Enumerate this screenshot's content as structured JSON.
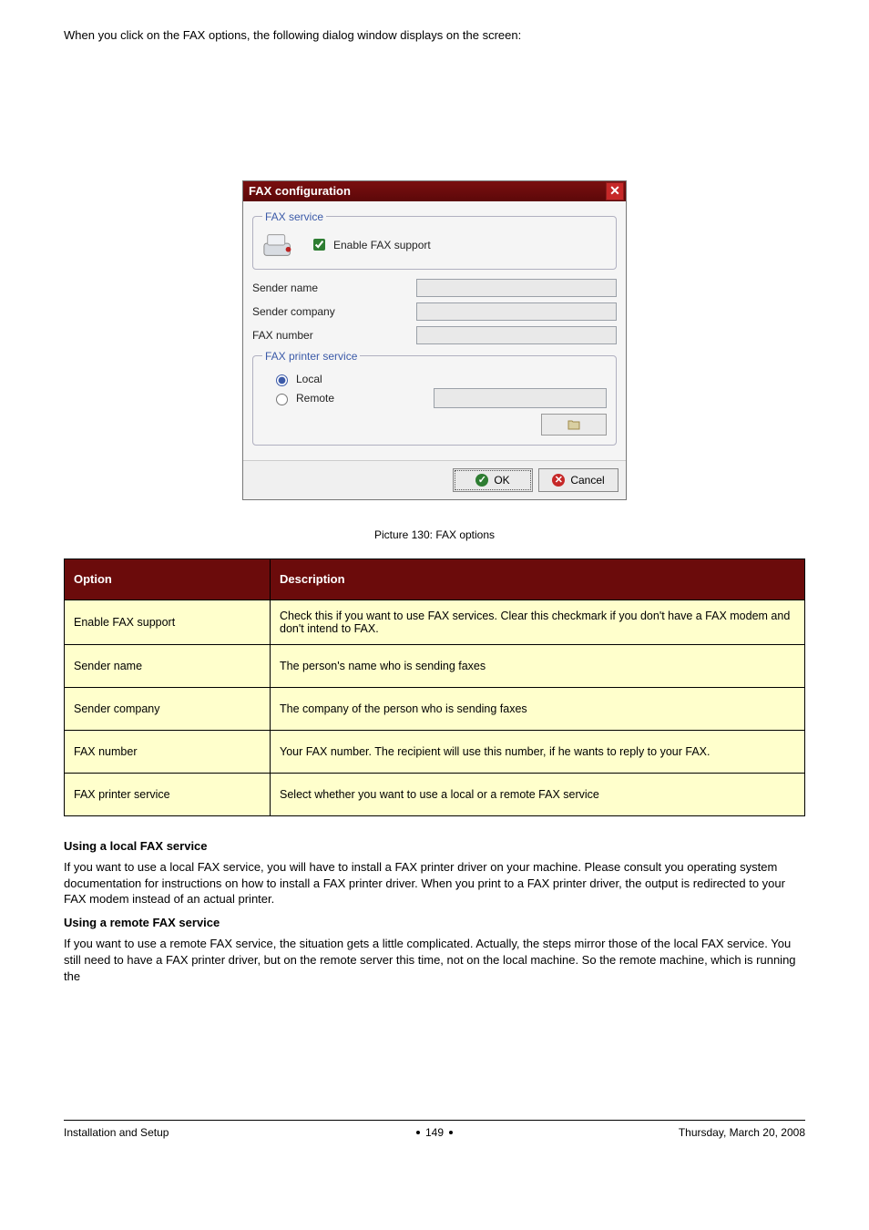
{
  "intro_paragraph": "When you click on the FAX options, the following dialog window displays on the screen:",
  "caption": "Picture 130: FAX options",
  "dialog": {
    "title": "FAX configuration",
    "group_fax_service_label": "FAX service",
    "enable_fax_label": "Enable FAX support",
    "enable_fax_checked": true,
    "fields": {
      "sender_name_label": "Sender name",
      "sender_name_value": "",
      "sender_company_label": "Sender company",
      "sender_company_value": "",
      "fax_number_label": "FAX number",
      "fax_number_value": ""
    },
    "group_printer_label": "FAX printer service",
    "radio_local_label": "Local",
    "radio_remote_label": "Remote",
    "radio_selected": "local",
    "remote_value": "",
    "ok_label": "OK",
    "cancel_label": "Cancel"
  },
  "table": {
    "headers": {
      "col1": "Option",
      "col2": "Description"
    },
    "rows": [
      {
        "opt": "Enable FAX support",
        "desc": "Check this if you want to use FAX services. Clear this checkmark if you don't have a FAX modem and don't intend to FAX."
      },
      {
        "opt": "Sender name",
        "desc": "The person's name who is sending faxes"
      },
      {
        "opt": "Sender company",
        "desc": "The company of the person who is sending faxes"
      },
      {
        "opt": "FAX number",
        "desc": "Your FAX number. The recipient will use this number, if he wants to reply to your FAX."
      },
      {
        "opt": "FAX printer service",
        "desc": "Select whether you want to use a local or a remote FAX service"
      }
    ]
  },
  "local_heading": "Using a local FAX service",
  "local_text": "If you want to use a local FAX service, you will have to install a FAX printer driver on your machine. Please consult you operating system documentation for instructions on how to install a FAX printer driver. When you print to a FAX printer driver, the output is redirected to your FAX modem instead of an actual printer.",
  "remote_heading": "Using a remote FAX service",
  "remote_text": "If you want to use a remote FAX service, the situation gets a little complicated. Actually, the steps mirror those of the local FAX service. You still need to have a FAX printer driver, but on the remote server this time, not on the local machine. So the remote machine, which is running the",
  "footer": {
    "left": "Installation and Setup",
    "center_page": "149",
    "right": "Thursday, March 20, 2008"
  }
}
